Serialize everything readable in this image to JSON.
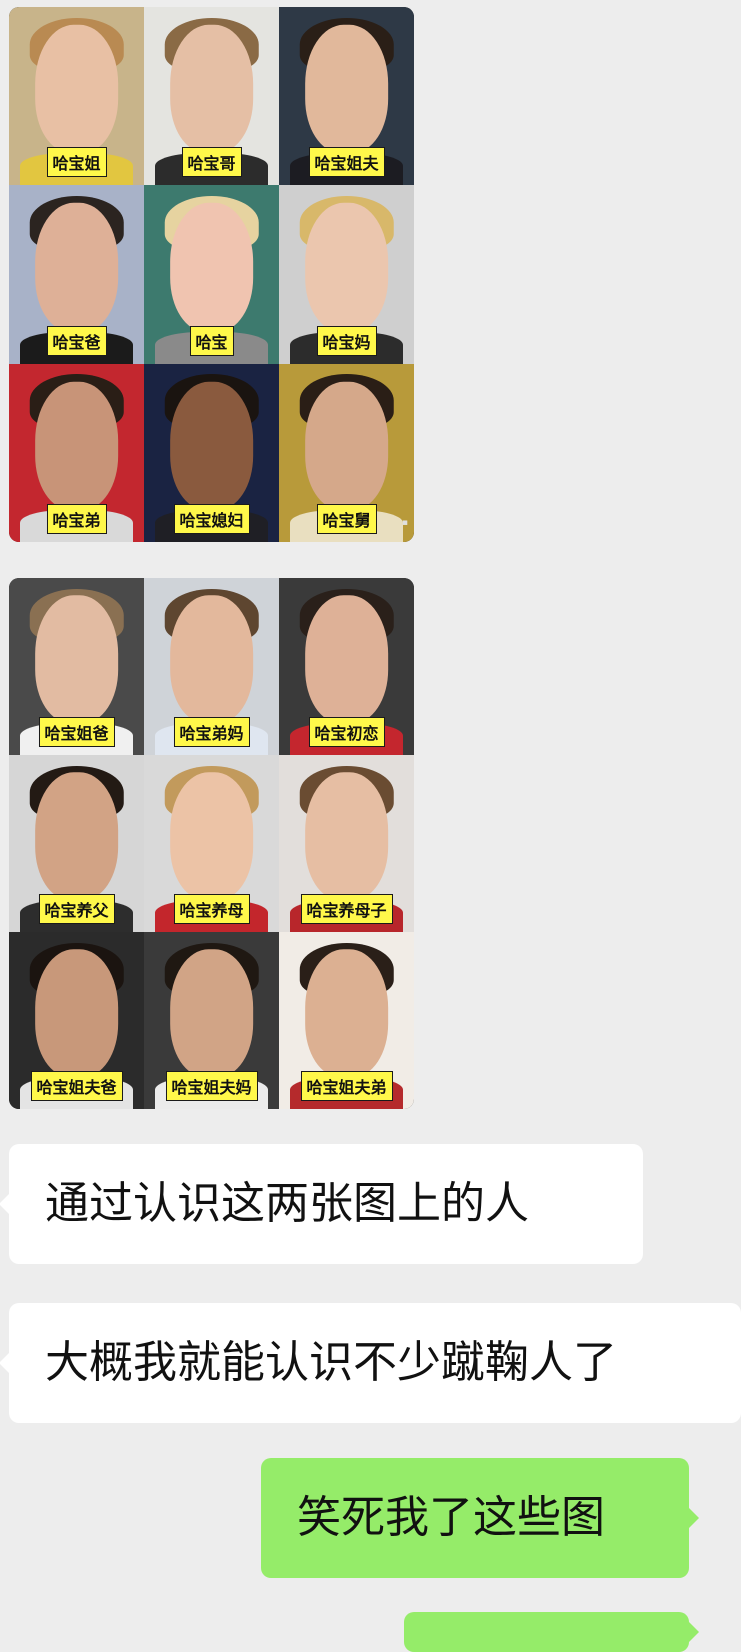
{
  "colors": {
    "chat_background": "#ededed",
    "incoming_bubble": "#ffffff",
    "outgoing_bubble": "#95ec69",
    "label_background": "#fff84a"
  },
  "image_message_1": {
    "labels": [
      "哈宝姐",
      "哈宝哥",
      "哈宝姐夫",
      "哈宝爸",
      "哈宝",
      "哈宝妈",
      "哈宝弟",
      "哈宝媳妇",
      "哈宝舅"
    ]
  },
  "image_message_2": {
    "labels": [
      "哈宝姐爸",
      "哈宝弟妈",
      "哈宝初恋",
      "哈宝养父",
      "哈宝养母",
      "哈宝养母子",
      "哈宝姐夫爸",
      "哈宝姐夫妈",
      "哈宝姐夫弟"
    ]
  },
  "messages": [
    {
      "direction": "incoming",
      "text": "通过认识这两张图上的人"
    },
    {
      "direction": "incoming",
      "text": "大概我就能认识不少蹴鞠人了"
    },
    {
      "direction": "outgoing",
      "text": "笑死我了这些图"
    }
  ]
}
